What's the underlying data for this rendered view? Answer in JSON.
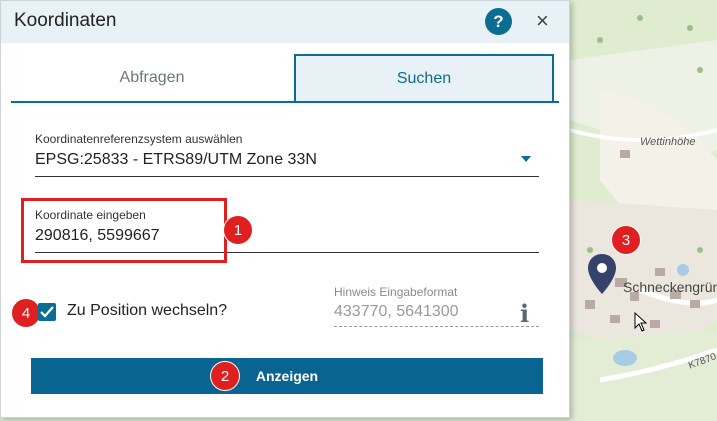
{
  "dialog": {
    "title": "Koordinaten",
    "help_label": "?",
    "close_label": "×"
  },
  "tabs": [
    {
      "label": "Abfragen",
      "active": false
    },
    {
      "label": "Suchen",
      "active": true
    }
  ],
  "crs": {
    "label": "Koordinatenreferenzsystem auswählen",
    "value": "EPSG:25833 - ETRS89/UTM Zone 33N"
  },
  "coordinate": {
    "label": "Koordinate eingeben",
    "value": "290816, 5599667"
  },
  "zoom_checkbox": {
    "label": "Zu Position wechseln?",
    "checked": true
  },
  "hint": {
    "label": "Hinweis Eingabeformat",
    "value": "433770, 5641300"
  },
  "submit_label": "Anzeigen",
  "badges": [
    "1",
    "2",
    "3",
    "4"
  ],
  "map": {
    "labels": [
      "Wettinhöhe",
      "Schneckengrün",
      "K7870"
    ]
  },
  "colors": {
    "accent": "#0c6d92",
    "highlight": "#e02020",
    "header_bg": "#e8f1f6"
  }
}
